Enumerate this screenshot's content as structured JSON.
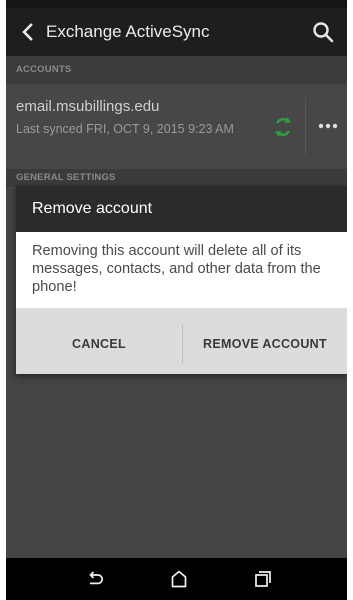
{
  "app_bar": {
    "title": "Exchange ActiveSync",
    "back_icon": "chevron-left-icon",
    "search_icon": "search-icon"
  },
  "sections": {
    "accounts_header": "ACCOUNTS",
    "general_header": "GENERAL SETTINGS"
  },
  "account": {
    "email": "email.msubillings.edu",
    "last_synced": "Last synced FRI, OCT 9, 2015 9:23 AM",
    "sync_icon": "sync-icon",
    "more_icon": "more-options-icon"
  },
  "dialog": {
    "title": "Remove account",
    "message": "Removing this account will delete all of its messages, contacts, and other data from the phone!",
    "cancel_label": "CANCEL",
    "confirm_label": "REMOVE ACCOUNT"
  },
  "nav_bar": {
    "back_icon": "back-icon",
    "home_icon": "home-icon",
    "recents_icon": "recents-icon"
  },
  "colors": {
    "sync_icon": "#2e9e44",
    "dialog_header": "#2b2b2b",
    "dim_background": "#444444"
  }
}
